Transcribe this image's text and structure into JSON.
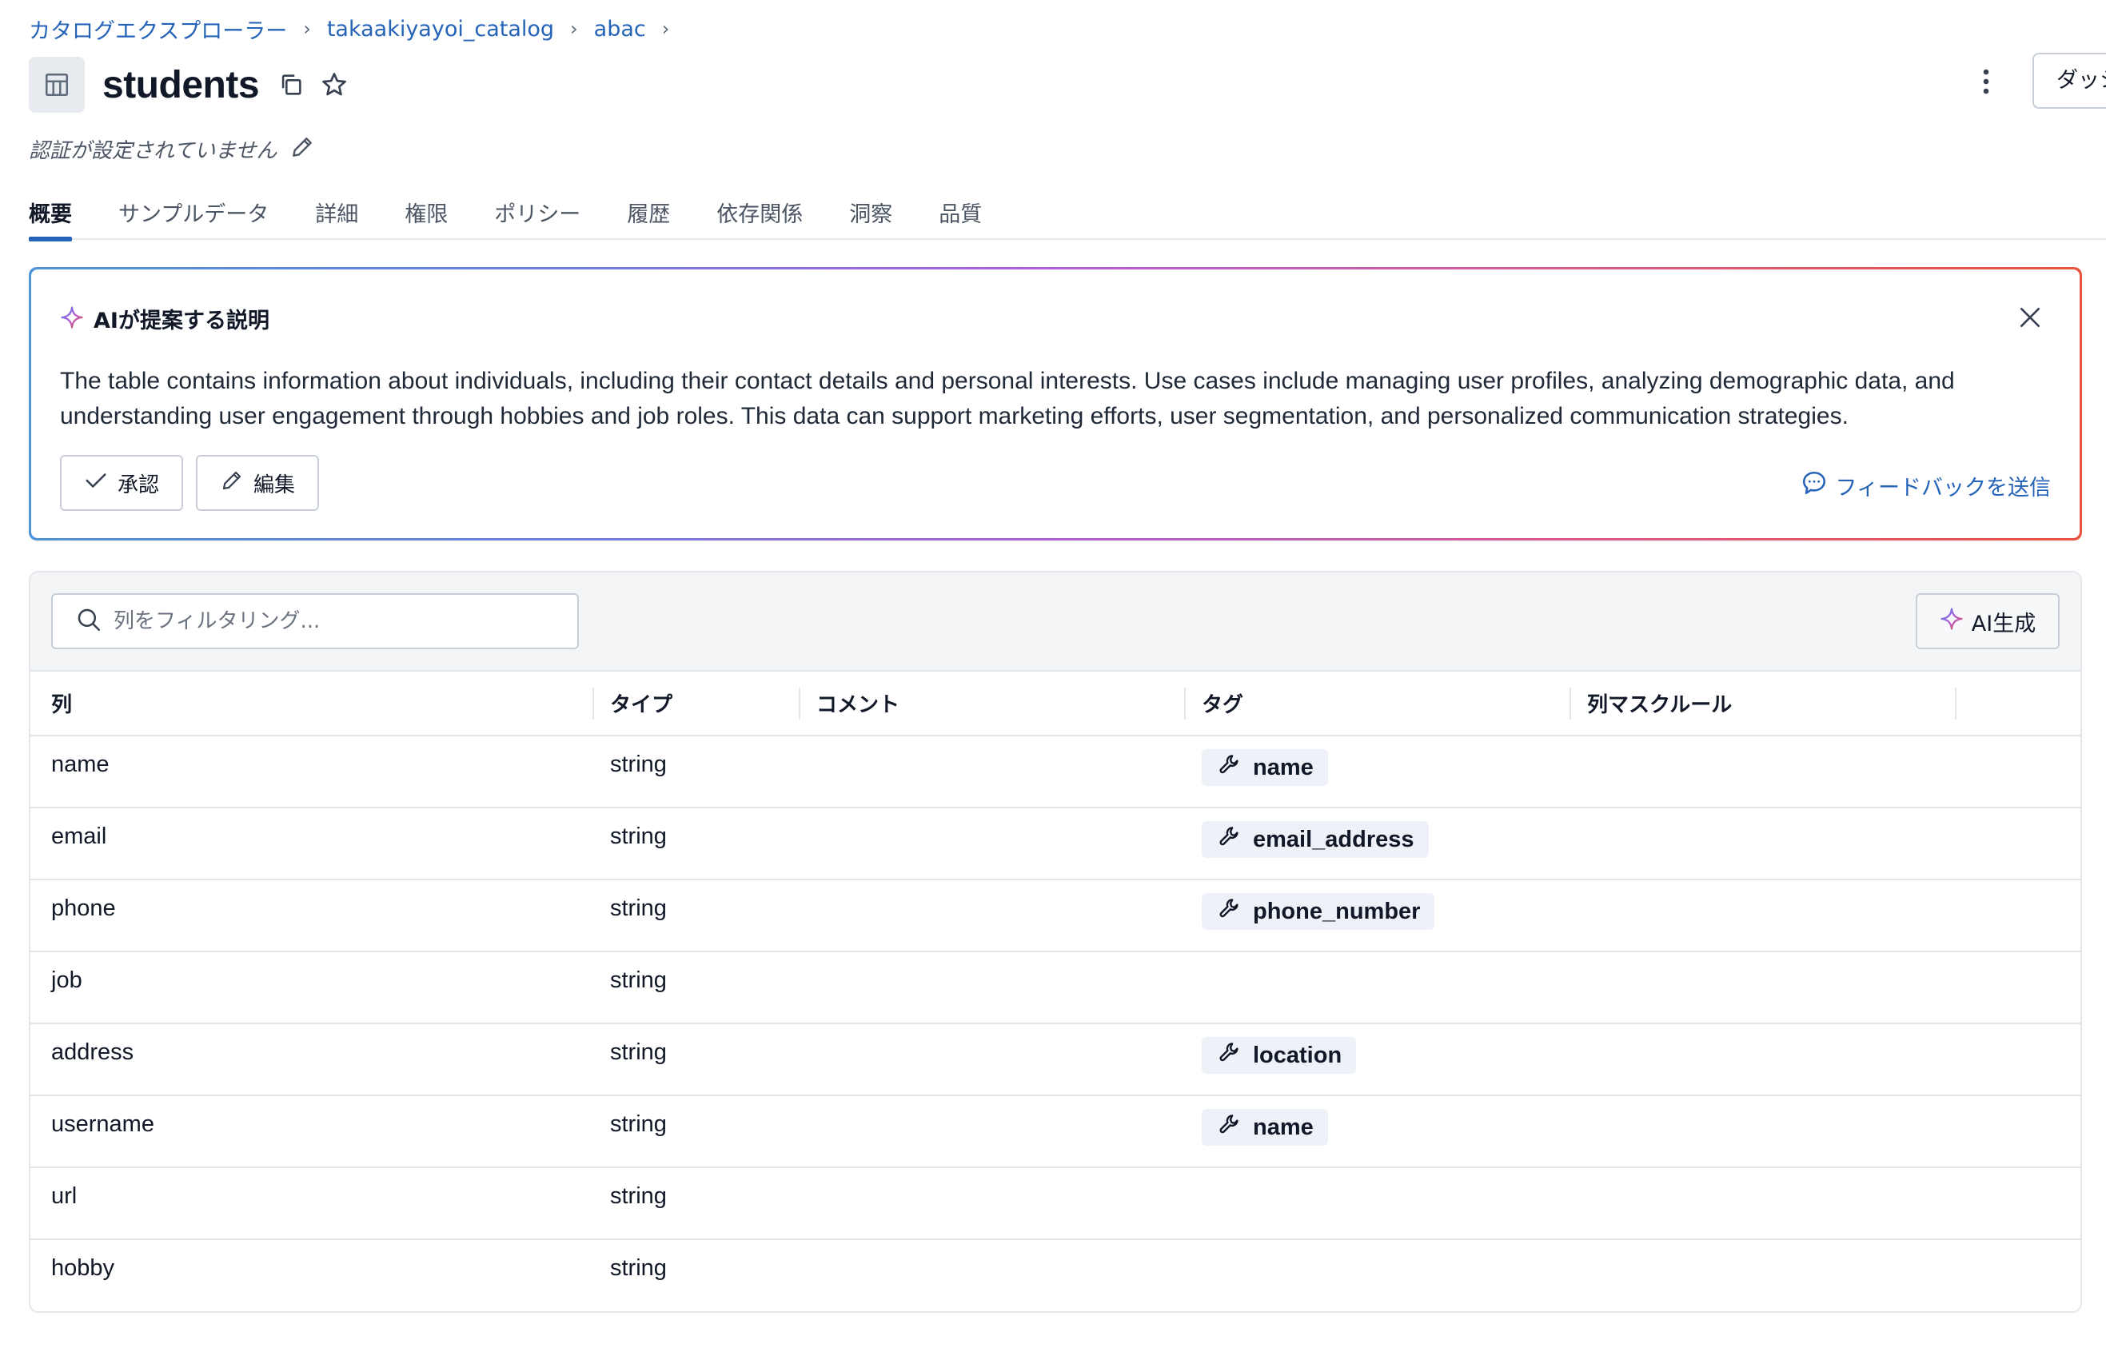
{
  "breadcrumb": [
    "カタログエクスプローラー",
    "takaakiyayoi_catalog",
    "abac"
  ],
  "header": {
    "title": "students",
    "certification_text": "認証が設定されていません",
    "dashboard_button_label": "ダッシ"
  },
  "tabs": [
    "概要",
    "サンプルデータ",
    "詳細",
    "権限",
    "ポリシー",
    "履歴",
    "依存関係",
    "洞察",
    "品質"
  ],
  "active_tab": "概要",
  "ai_suggestion": {
    "heading": "AIが提案する説明",
    "description": "The table contains information about individuals, including their contact details and personal interests. Use cases include managing user profiles, analyzing demographic data, and understanding user engagement through hobbies and job roles. This data can support marketing efforts, user segmentation, and personalized communication strategies.",
    "approve_label": "承認",
    "edit_label": "編集",
    "feedback_label": "フィードバックを送信"
  },
  "columns_panel": {
    "filter_placeholder": "列をフィルタリング...",
    "ai_generate_label": "AI生成",
    "headers": [
      "列",
      "タイプ",
      "コメント",
      "タグ",
      "列マスクルール"
    ],
    "rows": [
      {
        "name": "name",
        "type": "string",
        "comment": "",
        "tag": "name",
        "mask": ""
      },
      {
        "name": "email",
        "type": "string",
        "comment": "",
        "tag": "email_address",
        "mask": ""
      },
      {
        "name": "phone",
        "type": "string",
        "comment": "",
        "tag": "phone_number",
        "mask": ""
      },
      {
        "name": "job",
        "type": "string",
        "comment": "",
        "tag": "",
        "mask": ""
      },
      {
        "name": "address",
        "type": "string",
        "comment": "",
        "tag": "location",
        "mask": ""
      },
      {
        "name": "username",
        "type": "string",
        "comment": "",
        "tag": "name",
        "mask": ""
      },
      {
        "name": "url",
        "type": "string",
        "comment": "",
        "tag": "",
        "mask": ""
      },
      {
        "name": "hobby",
        "type": "string",
        "comment": "",
        "tag": "",
        "mask": ""
      }
    ]
  },
  "icons": {
    "table": "table-icon",
    "copy": "copy-icon",
    "star": "star-icon",
    "kebab": "kebab-menu-icon",
    "pencil": "pencil-icon",
    "sparkle": "sparkle-icon",
    "close": "close-icon",
    "check": "check-icon",
    "feedback": "chat-bubble-icon",
    "search": "search-icon",
    "tag": "wrench-icon"
  },
  "colors": {
    "link": "#2563b8",
    "accent_tab": "#2563b8",
    "tag_background": "#eef2f8",
    "panel_toolbar": "#f3f5f7"
  }
}
